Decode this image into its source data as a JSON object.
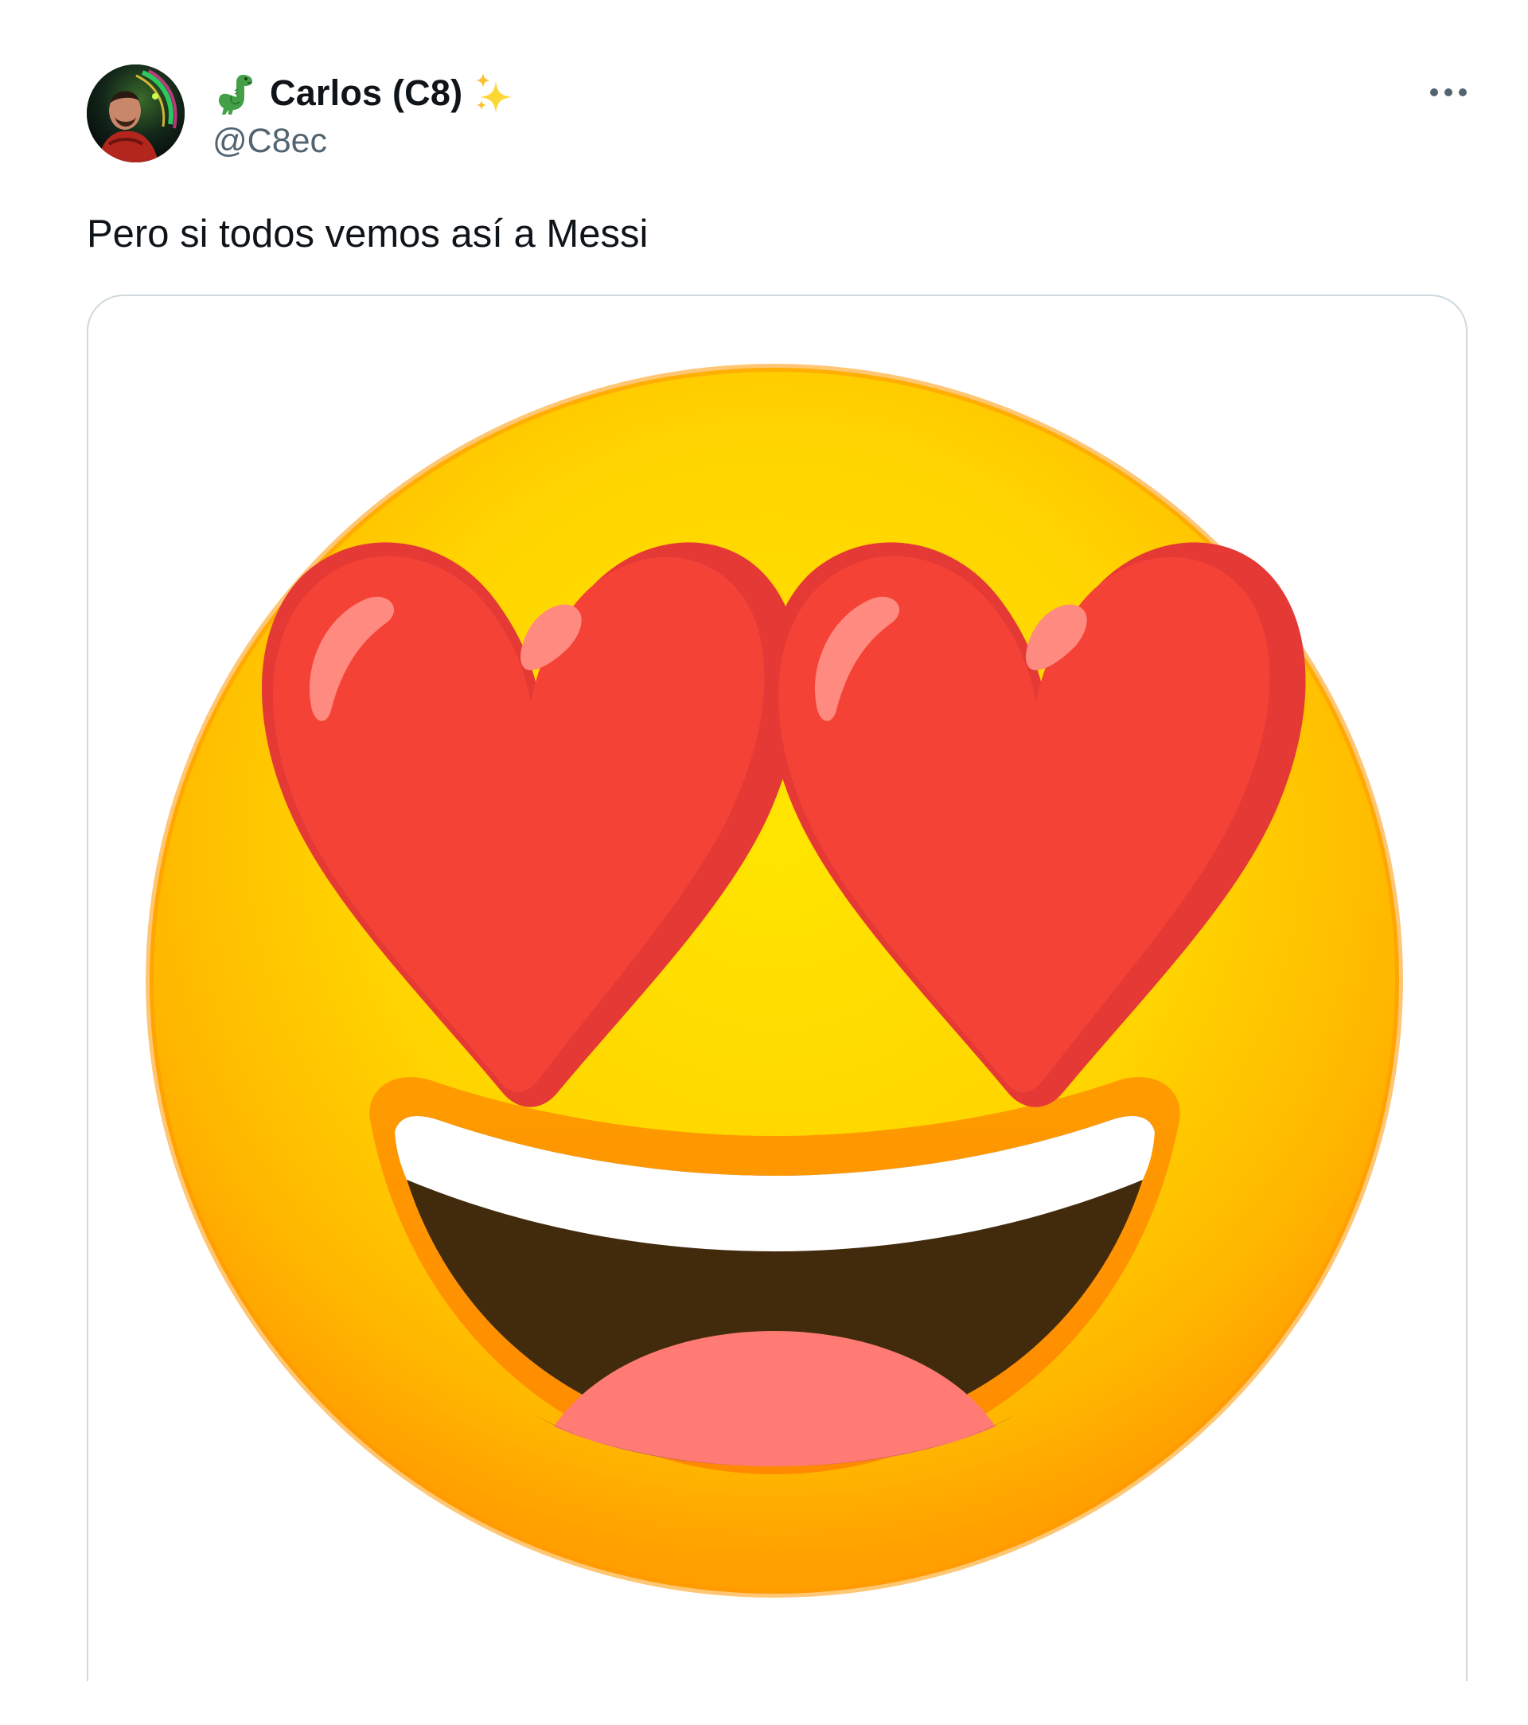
{
  "tweet": {
    "author": {
      "display_name": "Carlos (C8)",
      "handle": "@C8ec",
      "name_prefix_icon": "dinosaur-emoji-icon",
      "name_suffix_icon": "sparkles-emoji-icon"
    },
    "more_icon": "more-options-icon",
    "text": "Pero si todos vemos así a Messi",
    "media": {
      "type": "image",
      "icon": "smiling-face-with-heart-eyes-emoji",
      "colors": {
        "face_top": "#ffe200",
        "face_edge": "#ff9d00",
        "heart": "#f44336",
        "heart_shade": "#e53935",
        "highlight": "#ff8a80",
        "mouth": "#422b0d",
        "teeth": "#ffffff",
        "tongue": "#ff7b73"
      }
    },
    "colors": {
      "text": "#0f1419",
      "secondary_text": "#536471",
      "border": "#cfd9de"
    }
  }
}
